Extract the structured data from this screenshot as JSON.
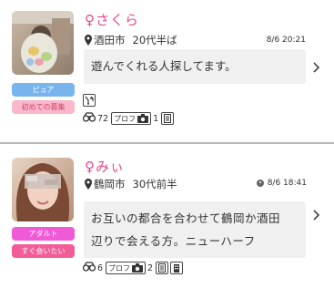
{
  "posts": [
    {
      "name": "♀さくら",
      "city": "酒田市",
      "age": "20代半ば",
      "time": "8/6 20:21",
      "message": "遊んでくれる人探してます。",
      "badges": [
        "ピュア",
        "初めての募集"
      ],
      "view_count": "72",
      "profile_label": "プロフ",
      "photo_count": "1"
    },
    {
      "name": "♀みぃ",
      "city": "鶴岡市",
      "age": "30代前半",
      "time": "8/6 18:41",
      "message_line1": "お互いの都合を合わせて鶴岡か酒田",
      "message_line2": "辺りで会える方。ニューハーフ",
      "badges": [
        "アダルト",
        "すぐ会いたい"
      ],
      "view_count": "6",
      "profile_label": "プロフ",
      "photo_count": "2"
    }
  ],
  "colors": {
    "name": "#e24a8d",
    "badge_blue": "#78b4ee",
    "badge_pink": "#f9b7ca",
    "badge_magenta": "#f15ad6",
    "badge_hotpink": "#f25d97"
  }
}
